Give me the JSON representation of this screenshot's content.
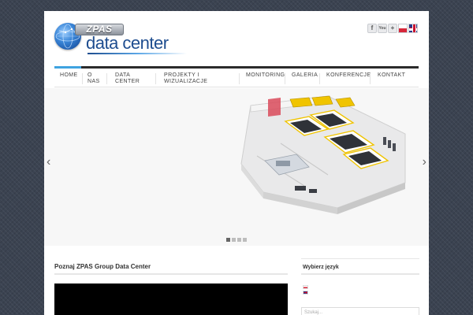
{
  "header": {
    "logo_badge": "ZPAS",
    "logo_text": "data center",
    "social_icons": [
      "facebook-icon",
      "youtube-icon",
      "plus-icon"
    ],
    "language_flags": [
      "polish-flag-icon",
      "uk-flag-icon"
    ]
  },
  "nav": {
    "items": [
      {
        "label": "HOME"
      },
      {
        "label": "O NAS"
      },
      {
        "label": "DATA CENTER"
      },
      {
        "label": "PROJEKTY I WIZUALIZACJE"
      },
      {
        "label": "MONITORING"
      },
      {
        "label": "GALERIA"
      },
      {
        "label": "KONFERENCJE"
      },
      {
        "label": "KONTAKT"
      }
    ],
    "active": "HOME"
  },
  "slider": {
    "image": "data-center-floorplan-render",
    "prev_arrow": "‹",
    "next_arrow": "›",
    "dot_count": 4,
    "active_dot": 1
  },
  "main": {
    "title": "Poznaj ZPAS Group Data Center"
  },
  "sidebar": {
    "title": "Wybierz język",
    "languages": [
      "polish-flag-icon",
      "uk-flag-icon"
    ],
    "search_placeholder": "Szukaj..."
  },
  "colors": {
    "accent": "#3fa3e0",
    "nav_bar": "#2b2b2b",
    "logo_blue": "#1e4d8f"
  }
}
